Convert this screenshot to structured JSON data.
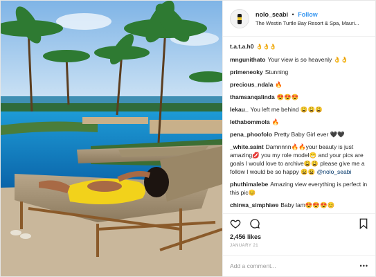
{
  "header": {
    "username": "nolo_seabi",
    "separator": "•",
    "follow_label": "Follow",
    "location": "The Westin Turtle Bay Resort & Spa, Mauri..."
  },
  "comments": [
    {
      "user": "t.a.t.a.h0",
      "text": "👌👌👌"
    },
    {
      "user": "mngunithato",
      "text": "Your view is so heavenly 👌👌"
    },
    {
      "user": "primeneoky",
      "text": "Stunning"
    },
    {
      "user": "precious_ndala",
      "text": "🔥"
    },
    {
      "user": "thamsanqalinda",
      "text": "😍😍😍"
    },
    {
      "user": "lekau_",
      "text": "You left me behind 😩😩😩"
    },
    {
      "user": "lethabommola",
      "text": "🔥"
    },
    {
      "user": "pena_phoofolo",
      "text": "Pretty Baby Girl ever 🖤🖤"
    },
    {
      "user": "_white.saint",
      "text": "Damnnnn🔥🔥your beauty is just amazing💋 you my role model😁 and your pics are goals I would love to archive😩😩 please give me a follow I would be so happy 😩😩",
      "mention": "@nolo_seabi"
    },
    {
      "user": "phuthimalebe",
      "text": "Amazing view everything is perfect in this pic😊"
    },
    {
      "user": "chirwa_simphiwe",
      "text": "Baby lam😍😍😍😊"
    }
  ],
  "likes": "2,456 likes",
  "date": "January 21",
  "add_comment_placeholder": "Add a comment...",
  "more_label": "•••",
  "icons": {
    "like": "heart-icon",
    "comment": "comment-icon",
    "save": "bookmark-icon"
  }
}
